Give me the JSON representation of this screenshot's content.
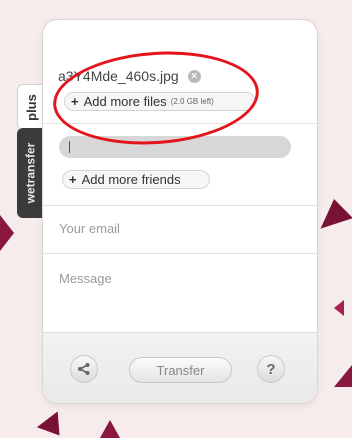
{
  "side_tabs": {
    "plus": "plus",
    "wetransfer": "wetransfer"
  },
  "files": {
    "file_name": "a3Y4Mde_460s.jpg",
    "remove_icon": "close-icon",
    "add_more_files": "Add more files",
    "quota": "(2.0 GB left)"
  },
  "friends": {
    "add_more_friends": "Add more friends"
  },
  "fields": {
    "email_placeholder": "Your email",
    "message_placeholder": "Message"
  },
  "footer": {
    "share_icon": "share-icon",
    "transfer": "Transfer",
    "help": "?"
  },
  "colors": {
    "accent": "#8a1740",
    "annotation": "#e4141c",
    "panel": "#ffffff"
  }
}
